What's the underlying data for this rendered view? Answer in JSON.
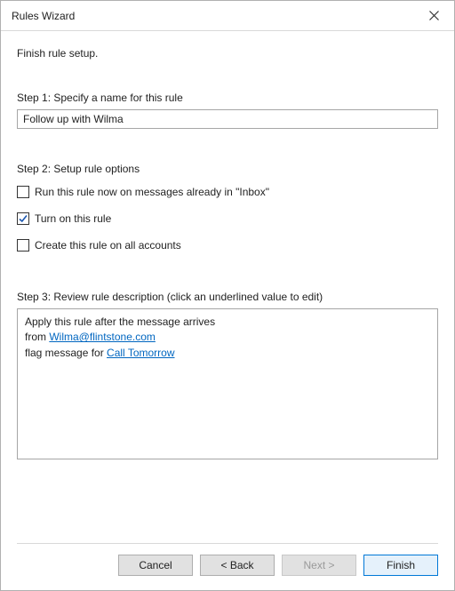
{
  "window": {
    "title": "Rules Wizard"
  },
  "intro": "Finish rule setup.",
  "step1": {
    "label": "Step 1: Specify a name for this rule",
    "value": "Follow up with Wilma"
  },
  "step2": {
    "label": "Step 2: Setup rule options",
    "options": [
      {
        "label": "Run this rule now on messages already in \"Inbox\"",
        "checked": false
      },
      {
        "label": "Turn on this rule",
        "checked": true
      },
      {
        "label": "Create this rule on all accounts",
        "checked": false
      }
    ]
  },
  "step3": {
    "label": "Step 3: Review rule description (click an underlined value to edit)",
    "line1": "Apply this rule after the message arrives",
    "from_prefix": "from ",
    "from_value": "Wilma@flintstone.com",
    "flag_prefix": "flag message for ",
    "flag_value": "Call Tomorrow"
  },
  "buttons": {
    "cancel": "Cancel",
    "back": "< Back",
    "next": "Next >",
    "finish": "Finish"
  }
}
